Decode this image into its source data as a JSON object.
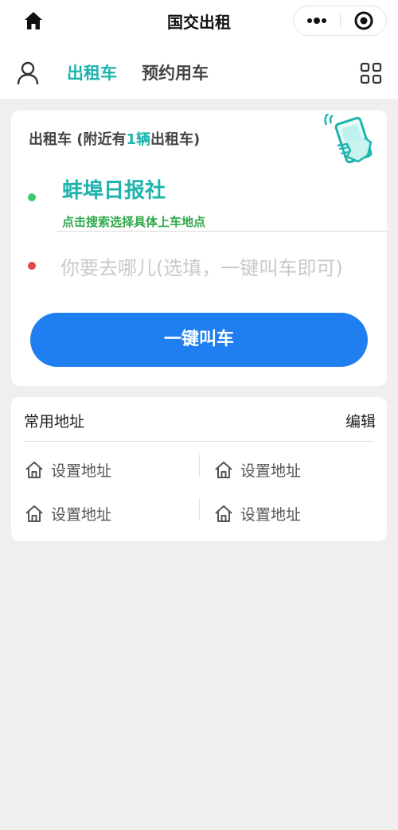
{
  "top_bar": {
    "title": "国交出租",
    "icons": [
      "home-icon",
      "more-dots-icon",
      "close-circle-icon"
    ]
  },
  "nav": {
    "tabs": [
      {
        "label": "出租车",
        "active": true
      },
      {
        "label": "预约用车",
        "active": false
      }
    ],
    "icons": [
      "user-icon",
      "grid-icon"
    ]
  },
  "booking": {
    "nearby_prefix": "出租车 (附近有",
    "nearby_count": "1辆",
    "nearby_suffix": "出租车)",
    "pickup_location": "蚌埠日报社",
    "pickup_hint": "点击搜索选择具体上车地点",
    "destination_placeholder": "你要去哪儿(选填，一键叫车即可)",
    "call_button": "一键叫车",
    "colors": {
      "accent": "#1eb3ac",
      "button": "#1f7ff0",
      "pickup_dot": "#3fc66b",
      "dest_dot": "#e64545"
    }
  },
  "favorites": {
    "title": "常用地址",
    "edit_label": "编辑",
    "items": [
      "设置地址",
      "设置地址",
      "设置地址",
      "设置地址"
    ]
  }
}
